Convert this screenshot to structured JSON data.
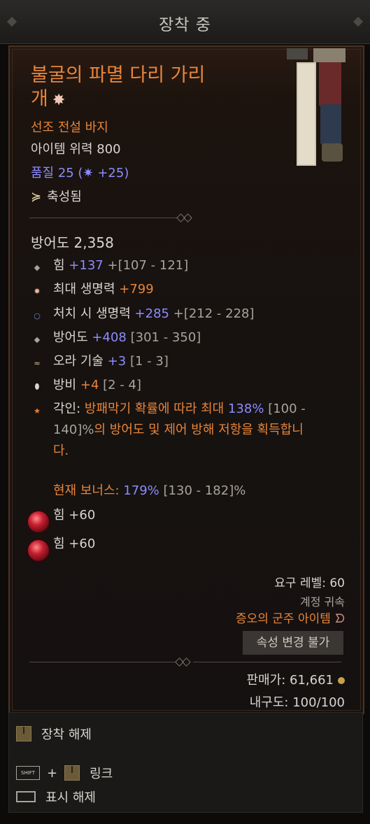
{
  "header": {
    "title": "장착 중"
  },
  "item": {
    "name_line1": "불굴의 파멸 다리 가리",
    "name_line2": "개",
    "type": "선조 전설 바지",
    "power": "아이템 위력 800",
    "quality_label": "품질 25",
    "quality_bonus": "+25",
    "blessed": "축성됨",
    "armor": "방어도 2,358"
  },
  "stats": [
    {
      "name": "힘",
      "value": "+137",
      "range": "+[107 - 121]"
    },
    {
      "name": "최대 생명력",
      "value": "+799"
    },
    {
      "name": "처치 시 생명력",
      "value": "+285",
      "range": "+[212 - 228]"
    },
    {
      "name": "방어도",
      "value": "+408",
      "range": "[301 - 350]"
    },
    {
      "name": "오라 기술",
      "value": "+3",
      "range": "[1 - 3]"
    },
    {
      "name": "방비",
      "value": "+4",
      "range": "[2 - 4]"
    }
  ],
  "aspect": {
    "label": "각인:",
    "line1_a": "방패막기 확률에 따라 최대",
    "line1_b": "138%",
    "line1_c": "[100 -",
    "line2_a": "140]%",
    "line2_b": "의 방어도 및 제어 방해 저항을 획득합니",
    "line3": "다."
  },
  "bonus": {
    "label": "현재 보너스:",
    "value": "179%",
    "range": "[130 - 182]%"
  },
  "sockets": [
    {
      "text": "힘 +60"
    },
    {
      "text": "힘 +60"
    }
  ],
  "requirements": {
    "level": "요구 레벨: 60",
    "account": "계정 귀속",
    "set": "증오의 군주 아이템"
  },
  "button_no_change": "속성 변경 불가",
  "sell": "판매가: 61,661",
  "durability": "내구도: 100/100",
  "footer": {
    "unequip": "장착 해제",
    "shift": "SHIFT",
    "plus": "+",
    "link": "링크",
    "hide": "표시 해제"
  },
  "colors": {
    "legendary": "#e8853a",
    "magic": "#8c8cff",
    "text": "#d8d6d0"
  }
}
